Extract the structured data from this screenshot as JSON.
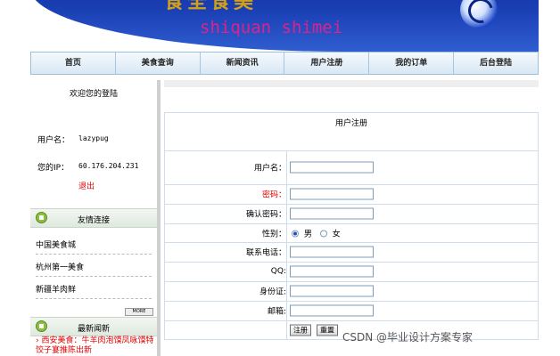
{
  "banner": {
    "title": "食全食美",
    "subtitle": "shiquan shimei"
  },
  "nav": {
    "items": [
      "首页",
      "美食查询",
      "新闻资讯",
      "用户注册",
      "我的订单",
      "后台登陆"
    ]
  },
  "sidebar": {
    "welcome": "欢迎您的登陆",
    "username_label": "用户名：",
    "username_value": "lazypug",
    "ip_label": "您的IP：",
    "ip_value": "60.176.204.231",
    "logout": "退出",
    "links_title": "友情连接",
    "links": [
      "中国美食城",
      "杭州第一美食",
      "新疆羊肉鲜"
    ],
    "more": "MORE",
    "news_title": "最新闻新",
    "news_items": [
      "西安美食：牛羊肉泡馍凤咏馍特  饺子宴推陈出新"
    ]
  },
  "form": {
    "title": "用户注册",
    "fields": [
      {
        "label": "用户名：",
        "value": ""
      },
      {
        "label": "密码：",
        "value": ""
      },
      {
        "label": "确认密码：",
        "value": ""
      },
      {
        "label": "性别："
      },
      {
        "label": "联系电话：",
        "value": ""
      },
      {
        "label": "QQ:",
        "value": ""
      },
      {
        "label": "身份证:",
        "value": ""
      },
      {
        "label": "邮箱:",
        "value": ""
      }
    ],
    "gender_male": "男",
    "gender_female": "女",
    "gender_selected": "男",
    "submit": "注册",
    "reset": "重置"
  },
  "watermark": "CSDN @毕业设计方案专家",
  "colors": {
    "accent_red": "#e00000",
    "nav_bg": "#d9e8f4",
    "banner_blue": "#1a3fb4"
  }
}
